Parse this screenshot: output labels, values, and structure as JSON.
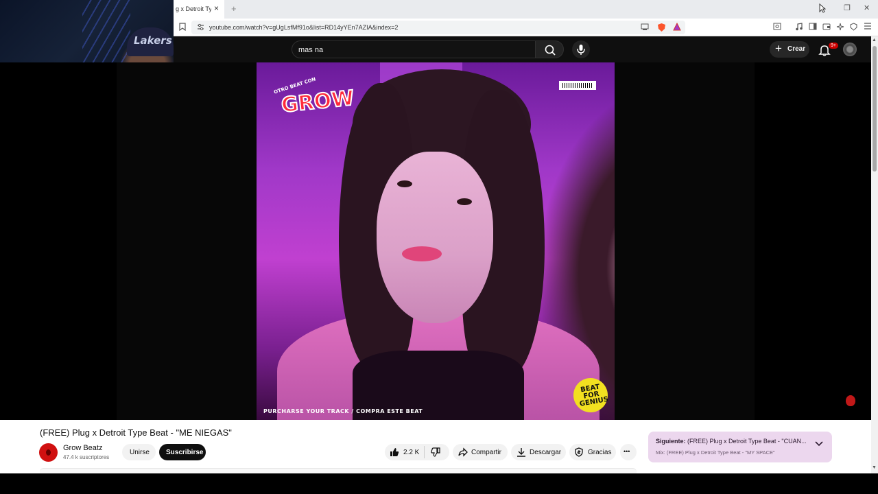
{
  "browser": {
    "tab_title": "g x Detroit Typ",
    "tab_close": "×",
    "new_tab": "+",
    "url": "youtube.com/watch?v=gUgLsfMf91o&list=RD14yYEn7AZIA&index=2",
    "window_controls": {
      "minimize": "—",
      "restore": "❐",
      "close": "✕"
    }
  },
  "youtube": {
    "search_value": "mas na",
    "create_label": "Crear",
    "notification_badge": "9+",
    "video_overlay": {
      "logo_small": "OTRO BEAT CON",
      "logo": "GROW",
      "caption": "PURCHARSE YOUR TRACK / COMPRA ESTE BEAT",
      "sticker": "BEAT FOR GENIUS"
    },
    "video": {
      "title": "(FREE) Plug x Detroit Type Beat - \"ME NIEGAS\"",
      "channel_name": "Grow Beatz",
      "subscribers": "47.4 k suscriptores",
      "join_label": "Unirse",
      "subscribe_label": "Suscribirse",
      "likes": "2.2 K",
      "share_label": "Compartir",
      "download_label": "Descargar",
      "thanks_label": "Gracias",
      "more_label": "•••"
    },
    "up_next": {
      "prefix": "Siguiente:",
      "title": "(FREE) Plug x Detroit Type Beat - \"CUAN...",
      "mix": "Mix: (FREE) Plug x Detroit Type Beat - \"MY SPACE\""
    }
  },
  "webcam": {
    "cap_text": "Lakers"
  }
}
